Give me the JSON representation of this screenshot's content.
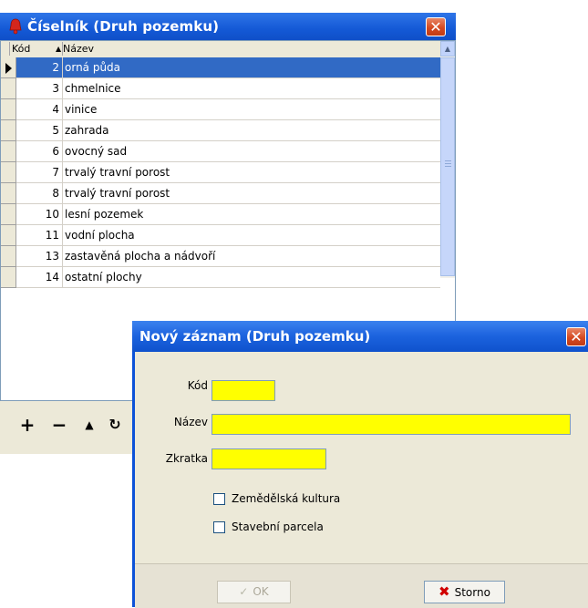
{
  "lookup_window": {
    "title": "Číselník (Druh pozemku)",
    "icon": "red-bell-icon",
    "close_glyph": "✕",
    "columns": {
      "kod": "Kód",
      "sort_glyph": "▲",
      "nazev": "Název"
    },
    "rows": [
      {
        "kod": "2",
        "nazev": "orná půda",
        "selected": true
      },
      {
        "kod": "3",
        "nazev": "chmelnice"
      },
      {
        "kod": "4",
        "nazev": "vinice"
      },
      {
        "kod": "5",
        "nazev": "zahrada"
      },
      {
        "kod": "6",
        "nazev": "ovocný sad"
      },
      {
        "kod": "7",
        "nazev": "trvalý travní porost"
      },
      {
        "kod": "8",
        "nazev": "trvalý travní porost"
      },
      {
        "kod": "10",
        "nazev": "lesní pozemek"
      },
      {
        "kod": "11",
        "nazev": "vodní plocha"
      },
      {
        "kod": "13",
        "nazev": "zastavěná plocha a nádvoří"
      },
      {
        "kod": "14",
        "nazev": "ostatní plochy"
      }
    ],
    "toolbar": {
      "add": "+",
      "delete": "−",
      "up": "▲",
      "refresh": "↻"
    }
  },
  "new_record_dialog": {
    "title": "Nový záznam (Druh pozemku)",
    "close_glyph": "✕",
    "fields": {
      "kod_label": "Kód",
      "kod_value": "",
      "nazev_label": "Název",
      "nazev_value": "",
      "zkratka_label": "Zkratka",
      "zkratka_value": ""
    },
    "checkboxes": {
      "zemedelska_kultura": "Zemědělská kultura",
      "stavebni_parcela": "Stavební parcela"
    },
    "buttons": {
      "ok": "OK",
      "ok_icon": "✓",
      "storno": "Storno",
      "storno_icon": "✖"
    }
  },
  "colors": {
    "titlebar": "#1459d6",
    "selection": "#316ac5",
    "required_field": "#ffff00",
    "close_button": "#d44a22"
  }
}
